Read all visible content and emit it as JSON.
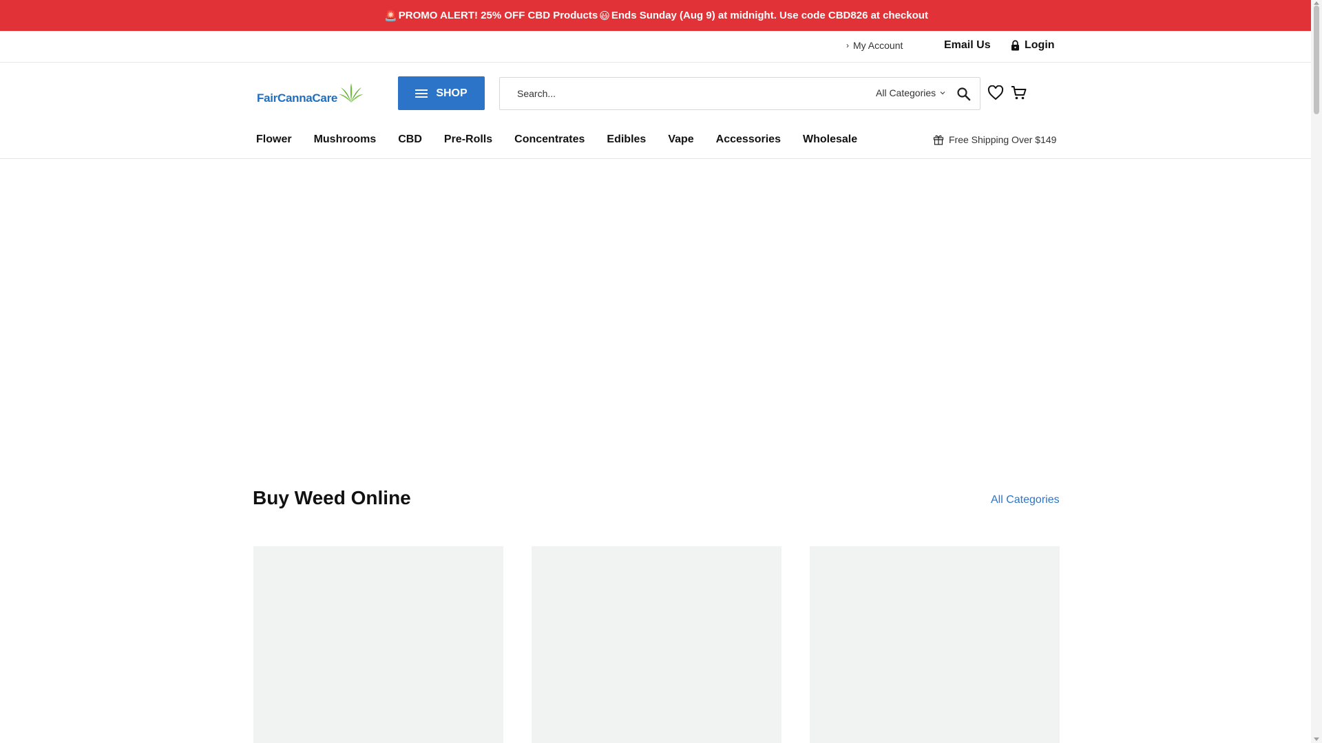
{
  "promo": {
    "part1": "PROMO ALERT! 25% OFF CBD Products",
    "part2": "Ends Sunday (Aug 9) at midnight. Use code CBD826 at checkout",
    "siren": "🚨",
    "smile": "😃",
    "color": "#e03237"
  },
  "utility": {
    "account_label": "My Account",
    "account_chevron": "›",
    "email_label": "Email Us",
    "login_label": "Login"
  },
  "header": {
    "logo_text": "FairCannaCare",
    "shop_label": "SHOP",
    "search_placeholder": "Search...",
    "category_select": "All Categories",
    "icons": [
      "menu-icon",
      "search-icon",
      "heart-icon",
      "cart-icon",
      "lock-icon",
      "leaf-icon"
    ]
  },
  "nav": {
    "items": [
      "Flower",
      "Mushrooms",
      "CBD",
      "Pre-Rolls",
      "Concentrates",
      "Edibles",
      "Vape",
      "Accessories",
      "Wholesale"
    ],
    "free_shipping": "Free Shipping Over $149"
  },
  "section": {
    "title": "Buy Weed Online",
    "all_categories": "All Categories"
  },
  "colors": {
    "accent": "#2b74c8",
    "promo": "#e03237",
    "placeholder_card": "#f1f2f2"
  }
}
